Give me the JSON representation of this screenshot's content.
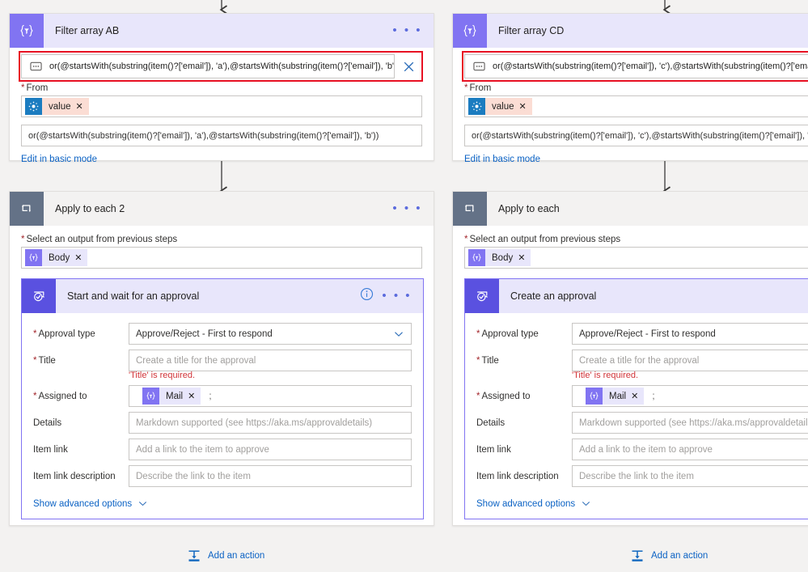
{
  "theme": {
    "canvas_bg": "#f3f2f1",
    "card_bg": "#ffffff",
    "accent_purple": "#8174f2",
    "accent_purple_dark": "#5a51e0",
    "header_lavender": "#e8e6fb",
    "loop_icon_bg": "#647287",
    "link_blue": "#0b62c4",
    "required_red": "#a4262c",
    "error_red": "#d13438",
    "annotation_red": "#e81123",
    "token_value_bg": "#fbddd4",
    "token_value_icon": "#1b7cc0",
    "token_purple_bg": "#e8e6fb"
  },
  "left_column": {
    "filter_card": {
      "icon": "filter-array-icon",
      "icon_glyph": "{∇}",
      "title": "Filter array AB",
      "overflow_label": "• • •",
      "expression": {
        "icon": "expression-icon",
        "value": "or(@startsWith(substring(item()?['email']), 'a'),@startsWith(substring(item()?['email']), 'b'))",
        "clear_label": "✕",
        "annotated": true
      },
      "from_label": "From",
      "from_required": true,
      "from_token": {
        "icon": "sharepoint-value-icon",
        "label": "value",
        "remove_label": "✕"
      },
      "condition_value": "or(@startsWith(substring(item()?['email']), 'a'),@startsWith(substring(item()?['email']), 'b'))",
      "basic_mode_link": "Edit in basic mode"
    },
    "loop_card": {
      "icon": "apply-to-each-icon",
      "title": "Apply to each 2",
      "overflow_label": "• • •",
      "output_label": "Select an output from previous steps",
      "output_required": true,
      "output_token": {
        "icon": "expression-body-icon",
        "icon_glyph": "{∇}",
        "label": "Body",
        "remove_label": "✕"
      },
      "approval_card": {
        "icon": "approvals-icon",
        "title": "Start and wait for an approval",
        "info_label": "i",
        "overflow_label": "• • •",
        "fields": [
          {
            "name": "approval-type",
            "label": "Approval type",
            "required": true,
            "value": "Approve/Reject - First to respond",
            "filled": true,
            "dropdown": true
          },
          {
            "name": "title",
            "label": "Title",
            "required": true,
            "placeholder": "Create a title for the approval",
            "filled": false,
            "error": "'Title' is required."
          },
          {
            "name": "assigned-to",
            "label": "Assigned to",
            "required": true,
            "token": {
              "icon": "expression-mail-icon",
              "icon_glyph": "{∇}",
              "label": "Mail",
              "remove_label": "✕"
            },
            "separator": ";"
          },
          {
            "name": "details",
            "label": "Details",
            "required": false,
            "placeholder": "Markdown supported (see https://aka.ms/approvaldetails)",
            "filled": false
          },
          {
            "name": "item-link",
            "label": "Item link",
            "required": false,
            "placeholder": "Add a link to the item to approve",
            "filled": false
          },
          {
            "name": "item-link-description",
            "label": "Item link description",
            "required": false,
            "placeholder": "Describe the link to the item",
            "filled": false
          }
        ],
        "advanced_link": "Show advanced options"
      },
      "add_action_label": "Add an action"
    }
  },
  "right_column": {
    "filter_card": {
      "icon": "filter-array-icon",
      "icon_glyph": "{∇}",
      "title": "Filter array CD",
      "expression": {
        "icon": "expression-icon",
        "value": "or(@startsWith(substring(item()?['email']), 'c'),@startsWith(substring(item()?['email']), 'd'))",
        "annotated": true
      },
      "from_label": "From",
      "from_required": true,
      "from_token": {
        "icon": "sharepoint-value-icon",
        "label": "value",
        "remove_label": "✕"
      },
      "condition_value": "or(@startsWith(substring(item()?['email']), 'c'),@startsWith(substring(item()?['email']), 'd'))",
      "basic_mode_link": "Edit in basic mode"
    },
    "loop_card": {
      "icon": "apply-to-each-icon",
      "title": "Apply to each",
      "output_label": "Select an output from previous steps",
      "output_required": true,
      "output_token": {
        "icon": "expression-body-icon",
        "icon_glyph": "{∇}",
        "label": "Body",
        "remove_label": "✕"
      },
      "approval_card": {
        "icon": "approvals-icon",
        "title": "Create an approval",
        "fields": [
          {
            "name": "approval-type",
            "label": "Approval type",
            "required": true,
            "value": "Approve/Reject - First to respond",
            "filled": true,
            "dropdown": false
          },
          {
            "name": "title",
            "label": "Title",
            "required": true,
            "placeholder": "Create a title for the approval",
            "filled": false,
            "error": "'Title' is required."
          },
          {
            "name": "assigned-to",
            "label": "Assigned to",
            "required": true,
            "token": {
              "icon": "expression-mail-icon",
              "icon_glyph": "{∇}",
              "label": "Mail",
              "remove_label": "✕"
            },
            "separator": ";"
          },
          {
            "name": "details",
            "label": "Details",
            "required": false,
            "placeholder": "Markdown supported (see https://aka.ms/approvaldetails)",
            "filled": false
          },
          {
            "name": "item-link",
            "label": "Item link",
            "required": false,
            "placeholder": "Add a link to the item to approve",
            "filled": false
          },
          {
            "name": "item-link-description",
            "label": "Item link description",
            "required": false,
            "placeholder": "Describe the link to the item",
            "filled": false
          }
        ],
        "advanced_link": "Show advanced options"
      },
      "add_action_label": "Add an action"
    }
  }
}
